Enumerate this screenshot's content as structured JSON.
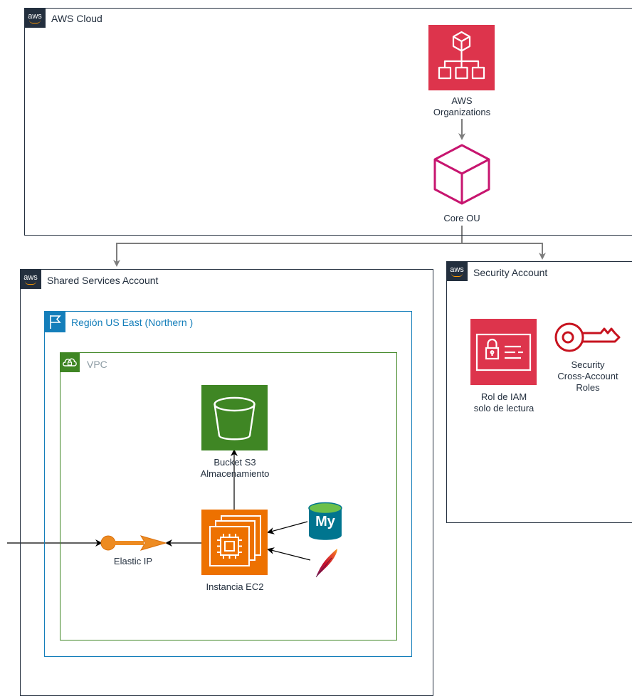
{
  "groups": {
    "aws_cloud": {
      "label": "AWS Cloud",
      "badge": "aws"
    },
    "shared_services": {
      "label": "Shared Services Account",
      "badge": "aws"
    },
    "security_account": {
      "label": "Security Account",
      "badge": "aws"
    },
    "region": {
      "label": "Región US East (Northern )"
    },
    "vpc": {
      "label": "VPC"
    }
  },
  "nodes": {
    "organizations": {
      "line1": "AWS",
      "line2": "Organizations"
    },
    "core_ou": {
      "label": "Core OU"
    },
    "iam_role": {
      "line1": "Rol de IAM",
      "line2": "solo de lectura"
    },
    "security_roles": {
      "line1": "Security",
      "line2": "Cross-Account",
      "line3": "Roles"
    },
    "s3_bucket": {
      "line1": "Bucket S3",
      "line2": "Almacenamiento"
    },
    "ec2": {
      "label": "Instancia EC2"
    },
    "elastic_ip": {
      "label": "Elastic IP"
    },
    "mysql": {
      "text": "My"
    }
  },
  "colors": {
    "border_dark": "#232f3e",
    "region_blue": "#147eba",
    "vpc_green": "#3f8624",
    "organizations_red": "#e7157b",
    "security_red": "#dd344c",
    "s3_green": "#3f8624",
    "ec2_orange": "#ed7100",
    "mysql_blue": "#00758f"
  }
}
